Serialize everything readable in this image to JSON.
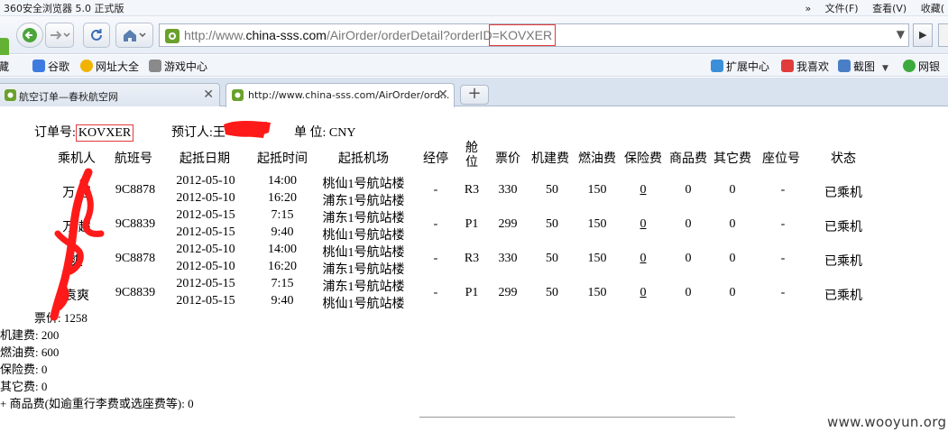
{
  "window": {
    "title": "360安全浏览器 5.0 正式版",
    "menus": [
      "»",
      "文件(F)",
      "查看(V)",
      "收藏("
    ]
  },
  "address": {
    "prefix": "http://www.",
    "domain": "china-sss.com",
    "path": "/AirOrder/orderDetail?orderID",
    "highlight": "=KOVXER"
  },
  "bookmarks": {
    "left": [
      {
        "label": "藏",
        "icon": "star-icon",
        "color": "#f2b01e"
      },
      {
        "label": "谷歌",
        "icon": "google-icon",
        "color": "#3d7be0"
      },
      {
        "label": "网址大全",
        "icon": "plus-icon",
        "color": "#f0b400"
      },
      {
        "label": "游戏中心",
        "icon": "gamepad-icon",
        "color": "#8a8a8a"
      }
    ],
    "right": [
      {
        "label": "扩展中心",
        "icon": "cube-icon",
        "color": "#3a8fd8"
      },
      {
        "label": "我喜欢",
        "icon": "heart-icon",
        "color": "#e03c3c"
      },
      {
        "label": "截图",
        "icon": "screenshot-icon",
        "color": "#4a7fc8"
      },
      {
        "label": "网银",
        "icon": "shield-icon",
        "color": "#3caa3c"
      }
    ]
  },
  "tabs": [
    {
      "label": "航空订单—春秋航空网",
      "active": false
    },
    {
      "label": "http://www.china-sss.com/AirOrder/ord...",
      "active": true
    }
  ],
  "order": {
    "number_label": "订单号:",
    "number": "KOVXER",
    "booker_label": "预订人:",
    "booker_visible": "王",
    "unit_label": "单  位:",
    "unit": "CNY"
  },
  "table": {
    "headers": [
      "乘机人",
      "航班号",
      "起抵日期",
      "起抵时间",
      "起抵机场",
      "经停",
      "舱位",
      "票价",
      "机建费",
      "燃油费",
      "保险费",
      "商品费",
      "其它费",
      "座位号",
      "状态"
    ],
    "rows": [
      {
        "passenger": "万  超",
        "flight": "9C8878",
        "date1": "2012-05-10",
        "date2": "2012-05-10",
        "time1": "14:00",
        "time2": "16:20",
        "ap1": "桃仙1号航站楼",
        "ap2": "浦东1号航站楼",
        "stop": "-",
        "cabin": "R3",
        "fare": "330",
        "airport_fee": "50",
        "fuel": "150",
        "insurance": "0",
        "goods": "0",
        "other": "0",
        "seat": "-",
        "status": "已乘机"
      },
      {
        "passenger": "万  超",
        "flight": "9C8839",
        "date1": "2012-05-15",
        "date2": "2012-05-15",
        "time1": "7:15",
        "time2": "9:40",
        "ap1": "浦东1号航站楼",
        "ap2": "桃仙1号航站楼",
        "stop": "-",
        "cabin": "P1",
        "fare": "299",
        "airport_fee": "50",
        "fuel": "150",
        "insurance": "0",
        "goods": "0",
        "other": "0",
        "seat": "-",
        "status": "已乘机"
      },
      {
        "passenger": "  爽",
        "flight": "9C8878",
        "date1": "2012-05-10",
        "date2": "2012-05-10",
        "time1": "14:00",
        "time2": "16:20",
        "ap1": "桃仙1号航站楼",
        "ap2": "浦东1号航站楼",
        "stop": "-",
        "cabin": "R3",
        "fare": "330",
        "airport_fee": "50",
        "fuel": "150",
        "insurance": "0",
        "goods": "0",
        "other": "0",
        "seat": "-",
        "status": "已乘机"
      },
      {
        "passenger": "袁爽",
        "flight": "9C8839",
        "date1": "2012-05-15",
        "date2": "2012-05-15",
        "time1": "7:15",
        "time2": "9:40",
        "ap1": "浦东1号航站楼",
        "ap2": "桃仙1号航站楼",
        "stop": "-",
        "cabin": "P1",
        "fare": "299",
        "airport_fee": "50",
        "fuel": "150",
        "insurance": "0",
        "goods": "0",
        "other": "0",
        "seat": "-",
        "status": "已乘机"
      }
    ]
  },
  "summary": {
    "fare": "票价: 1258",
    "airport_fee": "机建费: 200",
    "fuel": "燃油费: 600",
    "insurance": "保险费: 0",
    "other": "其它费: 0",
    "goods": "+  商品费(如逾重行李费或选座费等): 0"
  },
  "watermark": "www.wooyun.org",
  "colors": {
    "highlight_box": "#e23a3a",
    "redaction": "#ff1a1a",
    "chrome_bg": "#e7edf6"
  }
}
